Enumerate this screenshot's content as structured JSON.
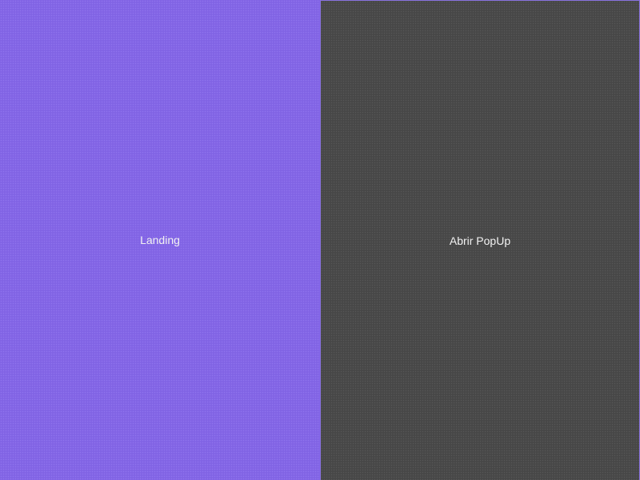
{
  "panels": {
    "left": {
      "label": "Landing",
      "color": "#8466e8"
    },
    "right": {
      "label": "Abrir PopUp",
      "color": "#4a4a4a",
      "border_color": "#8a73e0"
    }
  }
}
